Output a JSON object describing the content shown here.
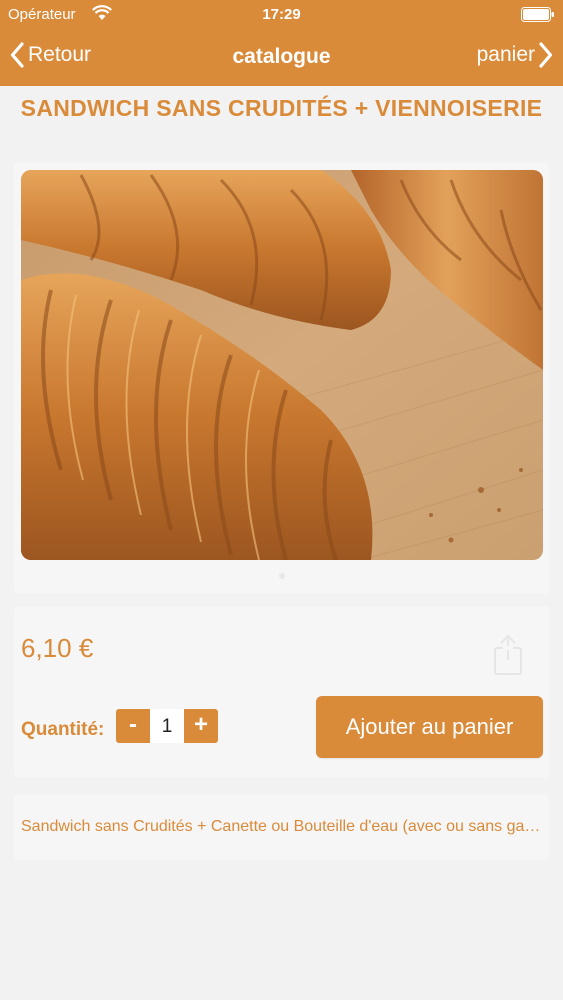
{
  "status_bar": {
    "carrier": "Opérateur",
    "time": "17:29"
  },
  "nav": {
    "back_label": "Retour",
    "title": "catalogue",
    "cart_label": "panier"
  },
  "product": {
    "title": "SANDWICH SANS CRUDITÉS + VIENNOISERIE",
    "price": "6,10 €",
    "quantity_label": "Quantité:",
    "minus": "-",
    "plus": "+",
    "quantity": "1",
    "add_to_cart": "Ajouter au panier",
    "description": "Sandwich sans Crudités + Canette ou Bouteille d'eau (avec ou sans gaz) + Viennoiserie"
  },
  "colors": {
    "accent": "#d98b3a",
    "background": "#f2f2f2"
  }
}
